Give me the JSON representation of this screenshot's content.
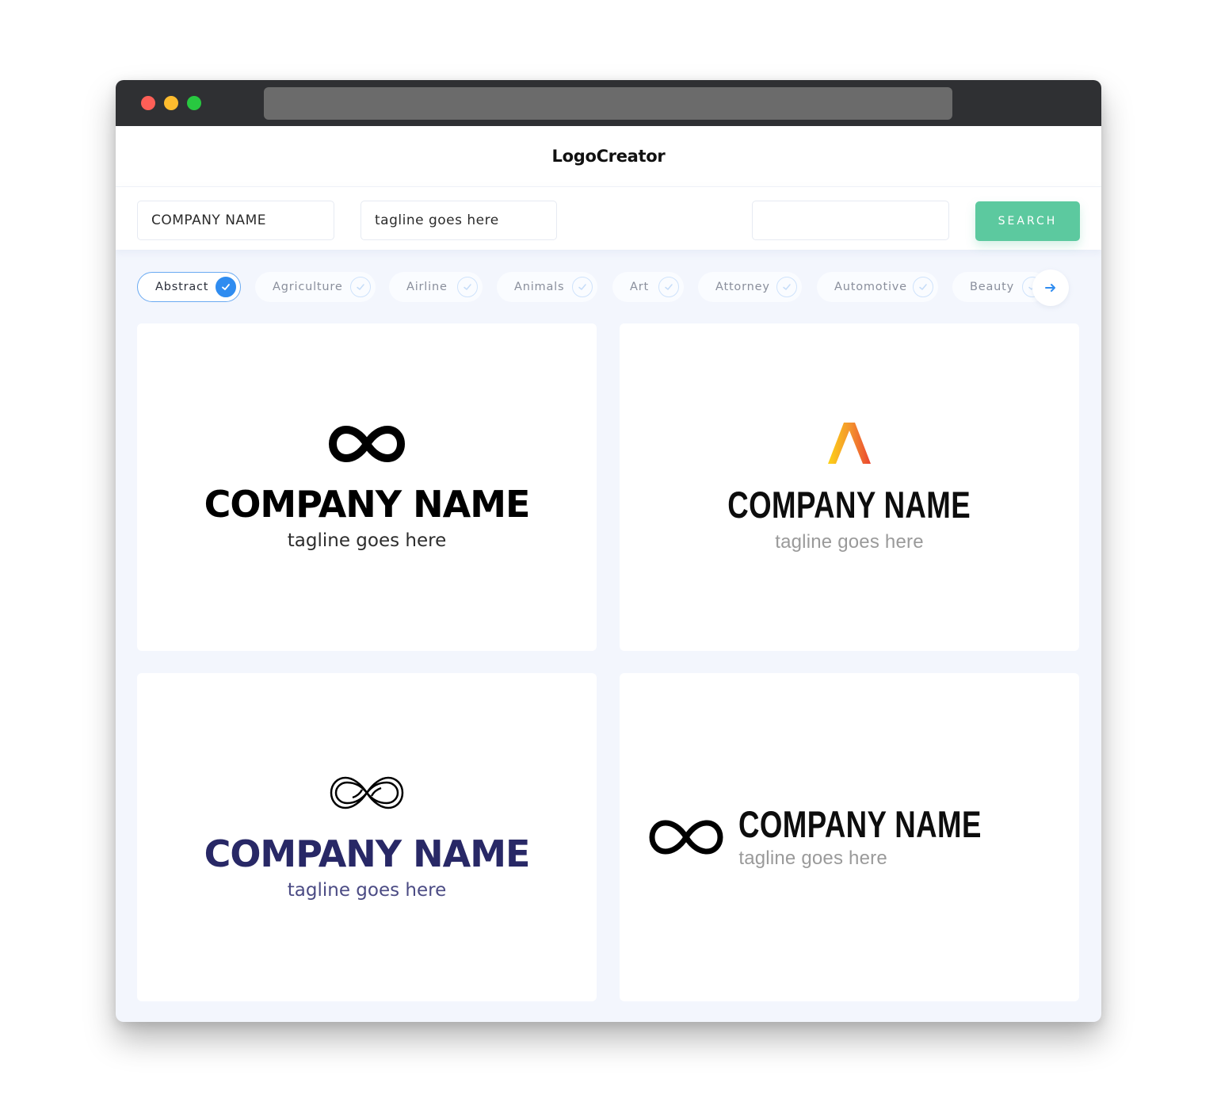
{
  "app": {
    "brand": "LogoCreator",
    "traffic_lights": [
      "close",
      "minimize",
      "maximize"
    ]
  },
  "search": {
    "company_name_value": "COMPANY NAME",
    "tagline_value": "tagline goes here",
    "keyword_value": "",
    "search_label": "SEARCH"
  },
  "categories": {
    "items": [
      {
        "label": "Abstract",
        "selected": true
      },
      {
        "label": "Agriculture",
        "selected": false
      },
      {
        "label": "Airline",
        "selected": false
      },
      {
        "label": "Animals",
        "selected": false
      },
      {
        "label": "Art",
        "selected": false
      },
      {
        "label": "Attorney",
        "selected": false
      },
      {
        "label": "Automotive",
        "selected": false
      },
      {
        "label": "Beauty",
        "selected": false
      }
    ],
    "next_icon": "arrow-right-icon"
  },
  "logos": [
    {
      "icon": "infinity-bold-icon",
      "company": "COMPANY NAME",
      "tagline": "tagline goes here",
      "name_color": "#000000",
      "tagline_color": "#2d2d2d",
      "layout": "stacked"
    },
    {
      "icon": "caret-up-gradient-icon",
      "company": "COMPANY NAME",
      "tagline": "tagline goes here",
      "name_color": "#0d0d0d",
      "tagline_color": "#9a9a9a",
      "layout": "stacked",
      "gradient": [
        "#fdd216",
        "#f3902f",
        "#ea4430"
      ]
    },
    {
      "icon": "infinity-outline-icon",
      "company": "COMPANY NAME",
      "tagline": "tagline goes here",
      "name_color": "#282866",
      "tagline_color": "#4b4b84",
      "layout": "stacked"
    },
    {
      "icon": "infinity-line-icon",
      "company": "COMPANY NAME",
      "tagline": "tagline goes here",
      "name_color": "#0d0d0d",
      "tagline_color": "#9a9a9a",
      "layout": "horizontal"
    }
  ],
  "colors": {
    "accent": "#2f8cf0",
    "search_button": "#5cc99f",
    "titlebar": "#2f3033",
    "page_bg": "#f3f6fd"
  }
}
